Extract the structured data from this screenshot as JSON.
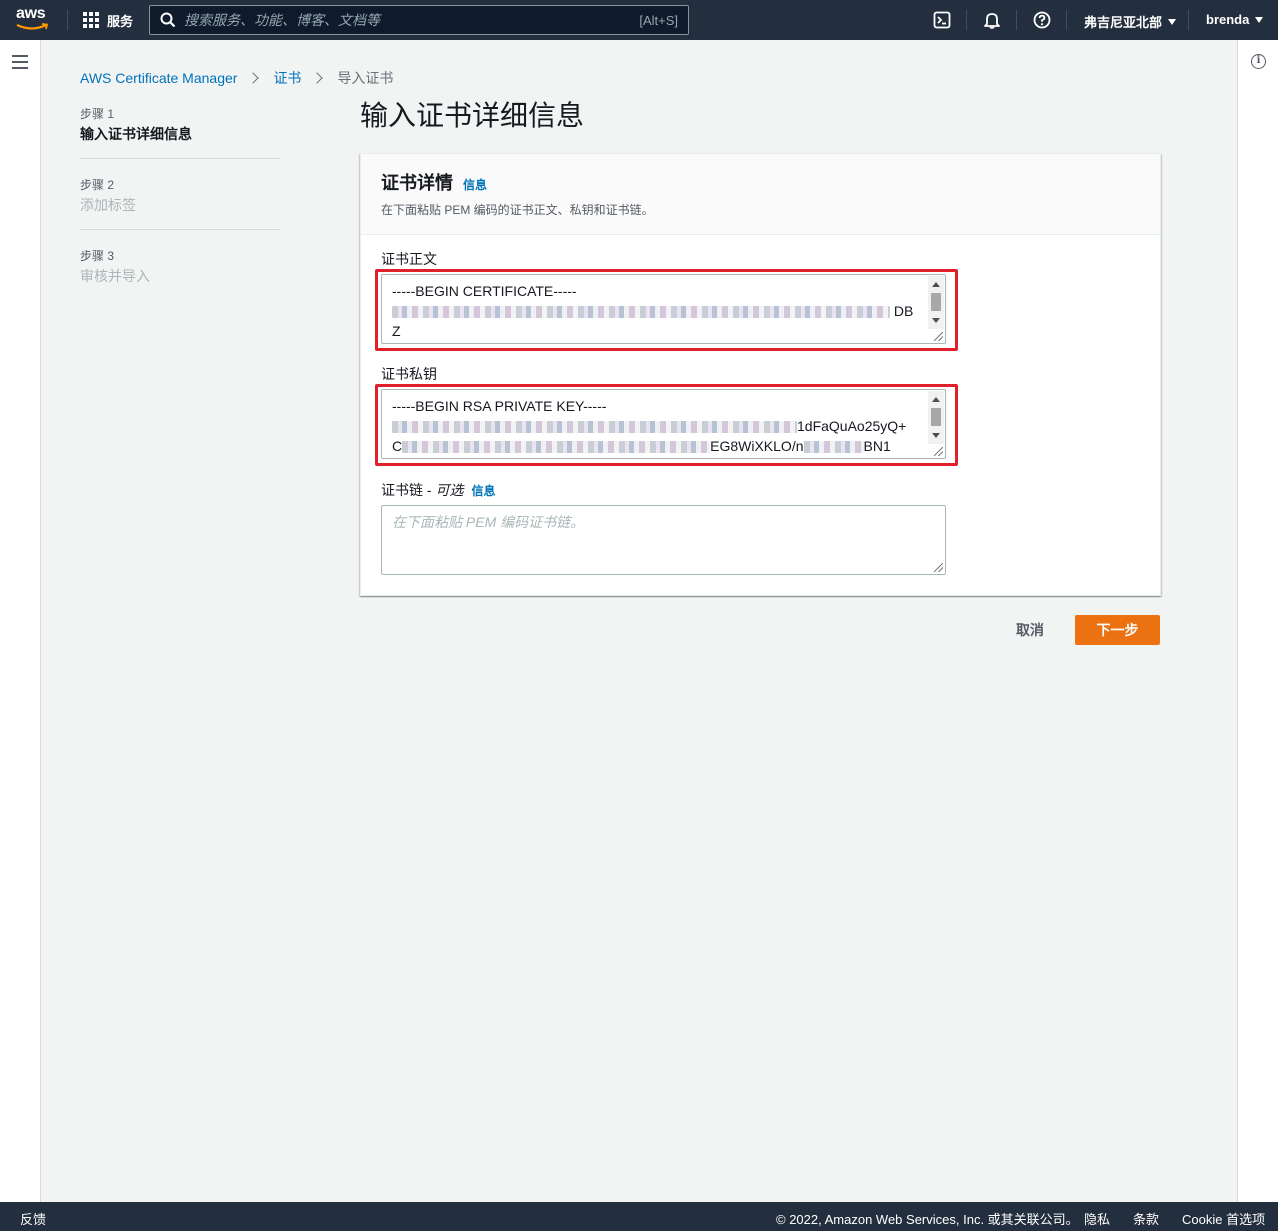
{
  "topnav": {
    "logo": "aws",
    "services_label": "服务",
    "search_placeholder": "搜索服务、功能、博客、文档等",
    "search_shortcut": "[Alt+S]",
    "region": "弗吉尼亚北部",
    "user": "brenda",
    "icons": [
      "cloudshell-icon",
      "bell-icon",
      "help-icon"
    ]
  },
  "breadcrumb": [
    "AWS Certificate Manager",
    "证书",
    "导入证书"
  ],
  "steps": [
    {
      "num": "步骤 1",
      "label": "输入证书详细信息",
      "state": "active"
    },
    {
      "num": "步骤 2",
      "label": "添加标签",
      "state": "disabled"
    },
    {
      "num": "步骤 3",
      "label": "审核并导入",
      "state": "disabled"
    }
  ],
  "page_title": "输入证书详细信息",
  "panel": {
    "title": "证书详情",
    "info": "信息",
    "description": "在下面粘贴 PEM 编码的证书正文、私钥和证书链。"
  },
  "fields": {
    "cert_body": {
      "label": "证书正文",
      "line1": "-----BEGIN CERTIFICATE-----",
      "line2_end": "DB",
      "line3": "Z"
    },
    "private_key": {
      "label": "证书私钥",
      "line1": "-----BEGIN RSA PRIVATE KEY-----",
      "line2_end": "1dFaQuAo25yQ+",
      "line3_start": "C",
      "line3_mid": "EG8WiXKLO/n",
      "line3_end": "BN1"
    },
    "cert_chain": {
      "label": "证书链 - ",
      "optional": "可选",
      "info": "信息",
      "placeholder": "在下面粘贴 PEM 编码证书链。"
    }
  },
  "buttons": {
    "cancel": "取消",
    "next": "下一步"
  },
  "footer": {
    "feedback": "反馈",
    "copyright": "© 2022, Amazon Web Services, Inc. 或其关联公司。",
    "privacy": "隐私",
    "terms": "条款",
    "cookie": "Cookie 首选项"
  },
  "colors": {
    "nav_bg": "#232f3e",
    "link": "#0073bb",
    "primary_button": "#ec7211",
    "highlight": "#e0202a"
  }
}
